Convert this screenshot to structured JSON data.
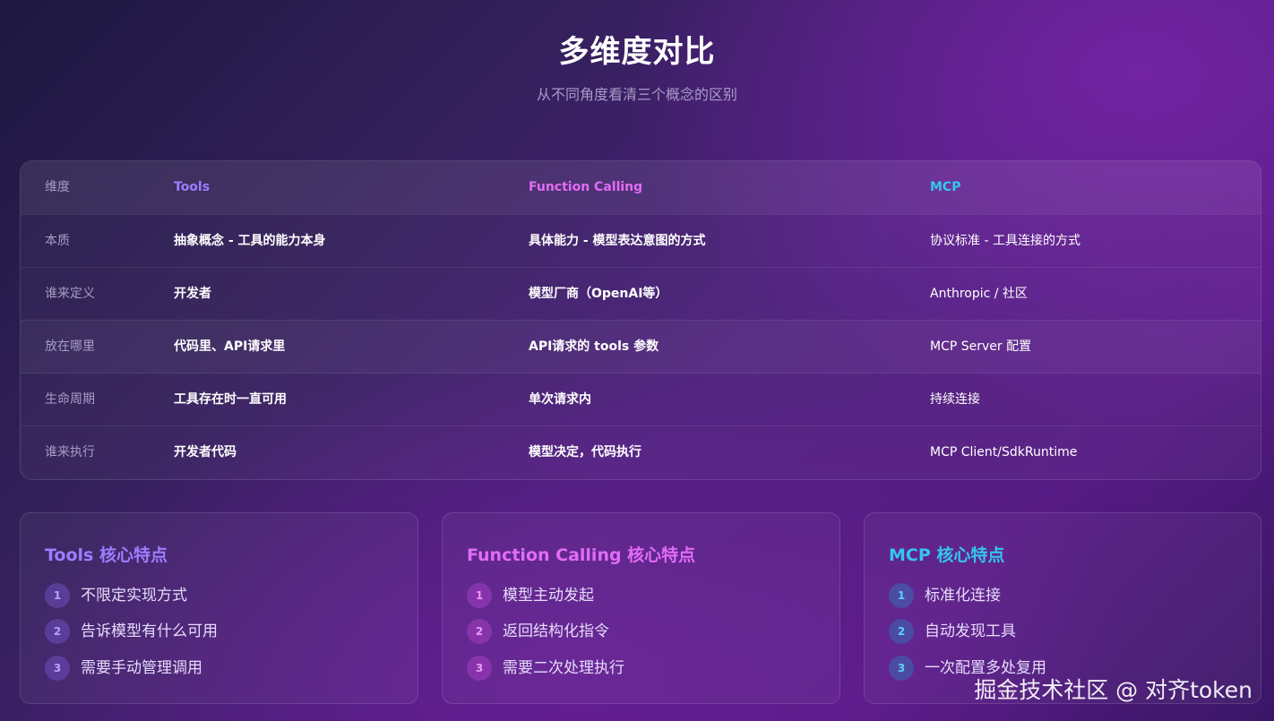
{
  "header": {
    "title": "多维度对比",
    "subtitle": "从不同角度看清三个概念的区别"
  },
  "table": {
    "columns": [
      "维度",
      "Tools",
      "Function Calling",
      "MCP"
    ],
    "rows": [
      [
        "本质",
        "抽象概念 - 工具的能力本身",
        "具体能力 - 模型表达意图的方式",
        "协议标准 - 工具连接的方式"
      ],
      [
        "谁来定义",
        "开发者",
        "模型厂商（OpenAI等）",
        "Anthropic / 社区"
      ],
      [
        "放在哪里",
        "代码里、API请求里",
        "API请求的 tools 参数",
        "MCP Server 配置"
      ],
      [
        "生命周期",
        "工具存在时一直可用",
        "单次请求内",
        "持续连接"
      ],
      [
        "谁来执行",
        "开发者代码",
        "模型决定，代码执行",
        "MCP Client/SdkRuntime"
      ]
    ]
  },
  "panels": [
    {
      "title": "Tools 核心特点",
      "items": [
        {
          "num": "1",
          "text": "不限定实现方式"
        },
        {
          "num": "2",
          "text": "告诉模型有什么可用"
        },
        {
          "num": "3",
          "text": "需要手动管理调用"
        }
      ]
    },
    {
      "title": "Function Calling 核心特点",
      "items": [
        {
          "num": "1",
          "text": "模型主动发起"
        },
        {
          "num": "2",
          "text": "返回结构化指令"
        },
        {
          "num": "3",
          "text": "需要二次处理执行"
        }
      ]
    },
    {
      "title": "MCP 核心特点",
      "items": [
        {
          "num": "1",
          "text": "标准化连接"
        },
        {
          "num": "2",
          "text": "自动发现工具"
        },
        {
          "num": "3",
          "text": "一次配置多处复用"
        }
      ]
    }
  ],
  "watermark": "掘金技术社区 @ 对齐token",
  "colors": {
    "tools": "#9d7dff",
    "function_calling": "#e26cf6",
    "mcp": "#33c6f0"
  }
}
